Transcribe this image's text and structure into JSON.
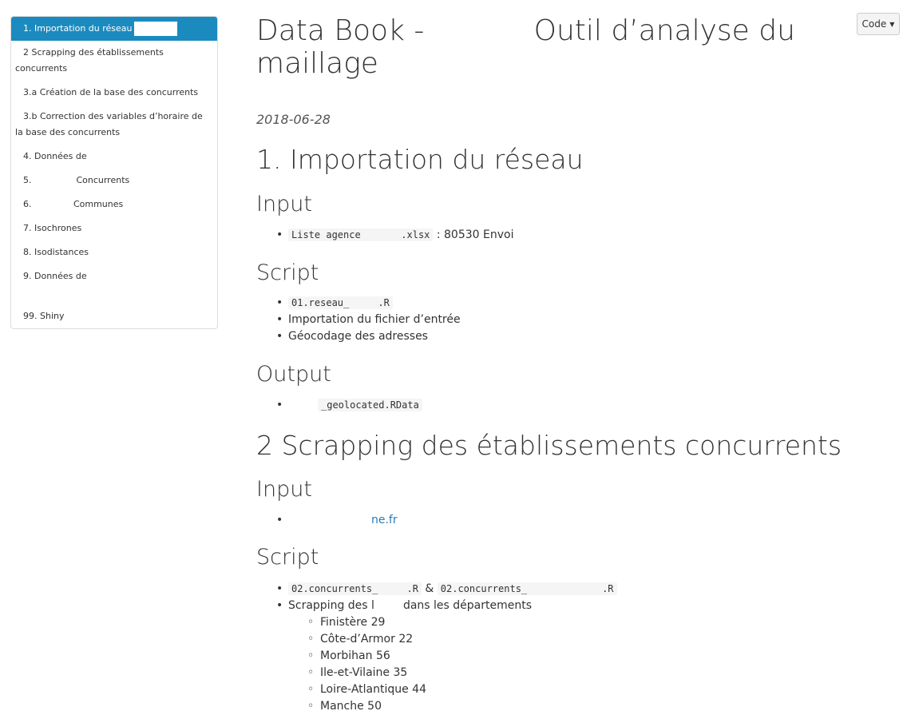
{
  "toc": {
    "items": [
      {
        "label": "1. Importation du réseau",
        "active": true
      },
      {
        "label": "2 Scrapping des établissements concurrents"
      },
      {
        "label": "3.a Création de la base des concurrents"
      },
      {
        "label": "3.b Correction des variables d’horaire de la base des concurrents"
      },
      {
        "label": "4. Données de"
      },
      {
        "label": "5.                Concurrents"
      },
      {
        "label": "6.               Communes"
      },
      {
        "label": "7. Isochrones"
      },
      {
        "label": "8. Isodistances"
      },
      {
        "label": "9. Données de"
      },
      {
        "label": "99. Shiny"
      }
    ]
  },
  "code_button": {
    "label": "Code"
  },
  "title": "Data Book -            Outil d’analyse du maillage",
  "date": "2018-06-28",
  "section1": {
    "heading": "1. Importation du réseau",
    "input_heading": "Input",
    "input_code": "Liste agence       .xlsx",
    "input_text": ": 80530 Envoi",
    "script_heading": "Script",
    "script_code": "01.reseau_     .R",
    "script_items": [
      "Importation du fichier d’entrée",
      "Géocodage des adresses"
    ],
    "output_heading": "Output",
    "output_code": "_geolocated.RData"
  },
  "section2": {
    "heading": "2 Scrapping des établissements concurrents",
    "input_heading": "Input",
    "input_link": "ne.fr",
    "script_heading": "Script",
    "script_code_a": "02.concurrents_     .R",
    "script_amp": "&",
    "script_code_b": "02.concurrents_             .R",
    "scrap_text_a": "Scrapping des l",
    "scrap_text_b": "dans les départements",
    "departments": [
      "Finistère 29",
      "Côte-d’Armor 22",
      "Morbihan 56",
      "Ile-et-Vilaine 35",
      "Loire-Atlantique 44",
      "Manche 50"
    ]
  }
}
